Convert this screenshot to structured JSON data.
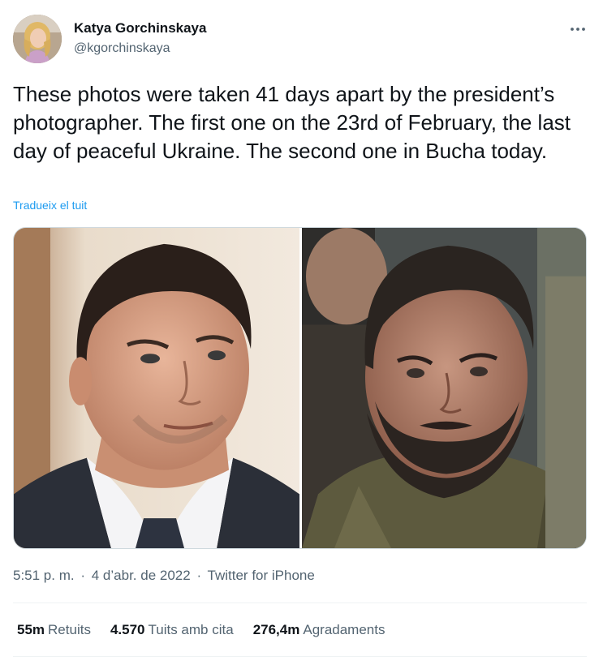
{
  "author": {
    "name": "Katya Gorchinskaya",
    "handle": "@kgorchinskaya"
  },
  "tweet": {
    "text": "These photos were taken 41 days apart by the president’s photographer. The first one on the 23rd of February, the last day of peaceful Ukraine. The second one in Bucha today.",
    "translate_label": "Tradueix el tuit"
  },
  "media": {
    "icons": [
      "photo-left",
      "photo-right"
    ]
  },
  "meta": {
    "time": "5:51 p. m.",
    "separator": "·",
    "date": "4 d’abr. de 2022",
    "source": "Twitter for iPhone"
  },
  "stats": {
    "retweets_count": "55m",
    "retweets_label": "Retuits",
    "quotes_count": "4.570",
    "quotes_label": "Tuits amb cita",
    "likes_count": "276,4m",
    "likes_label": "Agradaments"
  },
  "colors": {
    "text": "#0f1419",
    "secondary": "#536471",
    "link": "#1d9bf0",
    "border": "#cfd9de",
    "divider": "#eff3f4"
  }
}
